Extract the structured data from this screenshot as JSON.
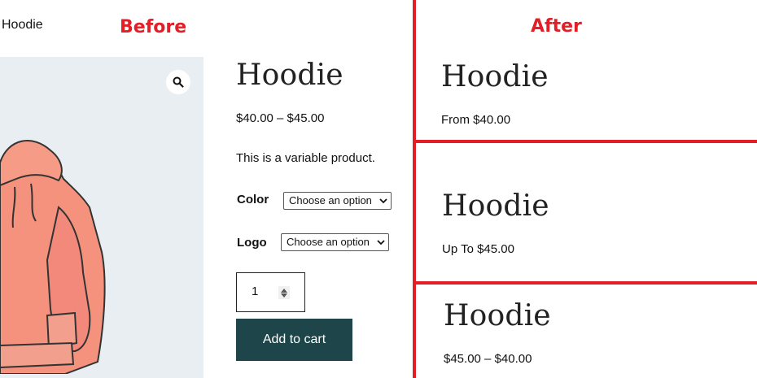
{
  "breadcrumb": "Hoodie",
  "annotations": {
    "before": "Before",
    "after": "After",
    "color": "#e41e26"
  },
  "product": {
    "title": "Hoodie",
    "price_range": "$40.00 – $45.00",
    "short_description": "This is a variable product.",
    "attributes": [
      {
        "label": "Color",
        "selected": "Choose an option"
      },
      {
        "label": "Logo",
        "selected": "Choose an option"
      }
    ],
    "quantity": "1",
    "add_to_cart_label": "Add to cart",
    "button_color": "#1e4549",
    "gallery_bg": "#e9eef2",
    "icons": {
      "zoom": "magnifier-icon",
      "select_arrow": "chevron-down-icon",
      "stepper": "stepper-arrows-icon"
    }
  },
  "after_examples": [
    {
      "title": "Hoodie",
      "price": "From $40.00"
    },
    {
      "title": "Hoodie",
      "price": "Up To $45.00"
    },
    {
      "title": "Hoodie",
      "price": "$45.00 – $40.00"
    }
  ]
}
